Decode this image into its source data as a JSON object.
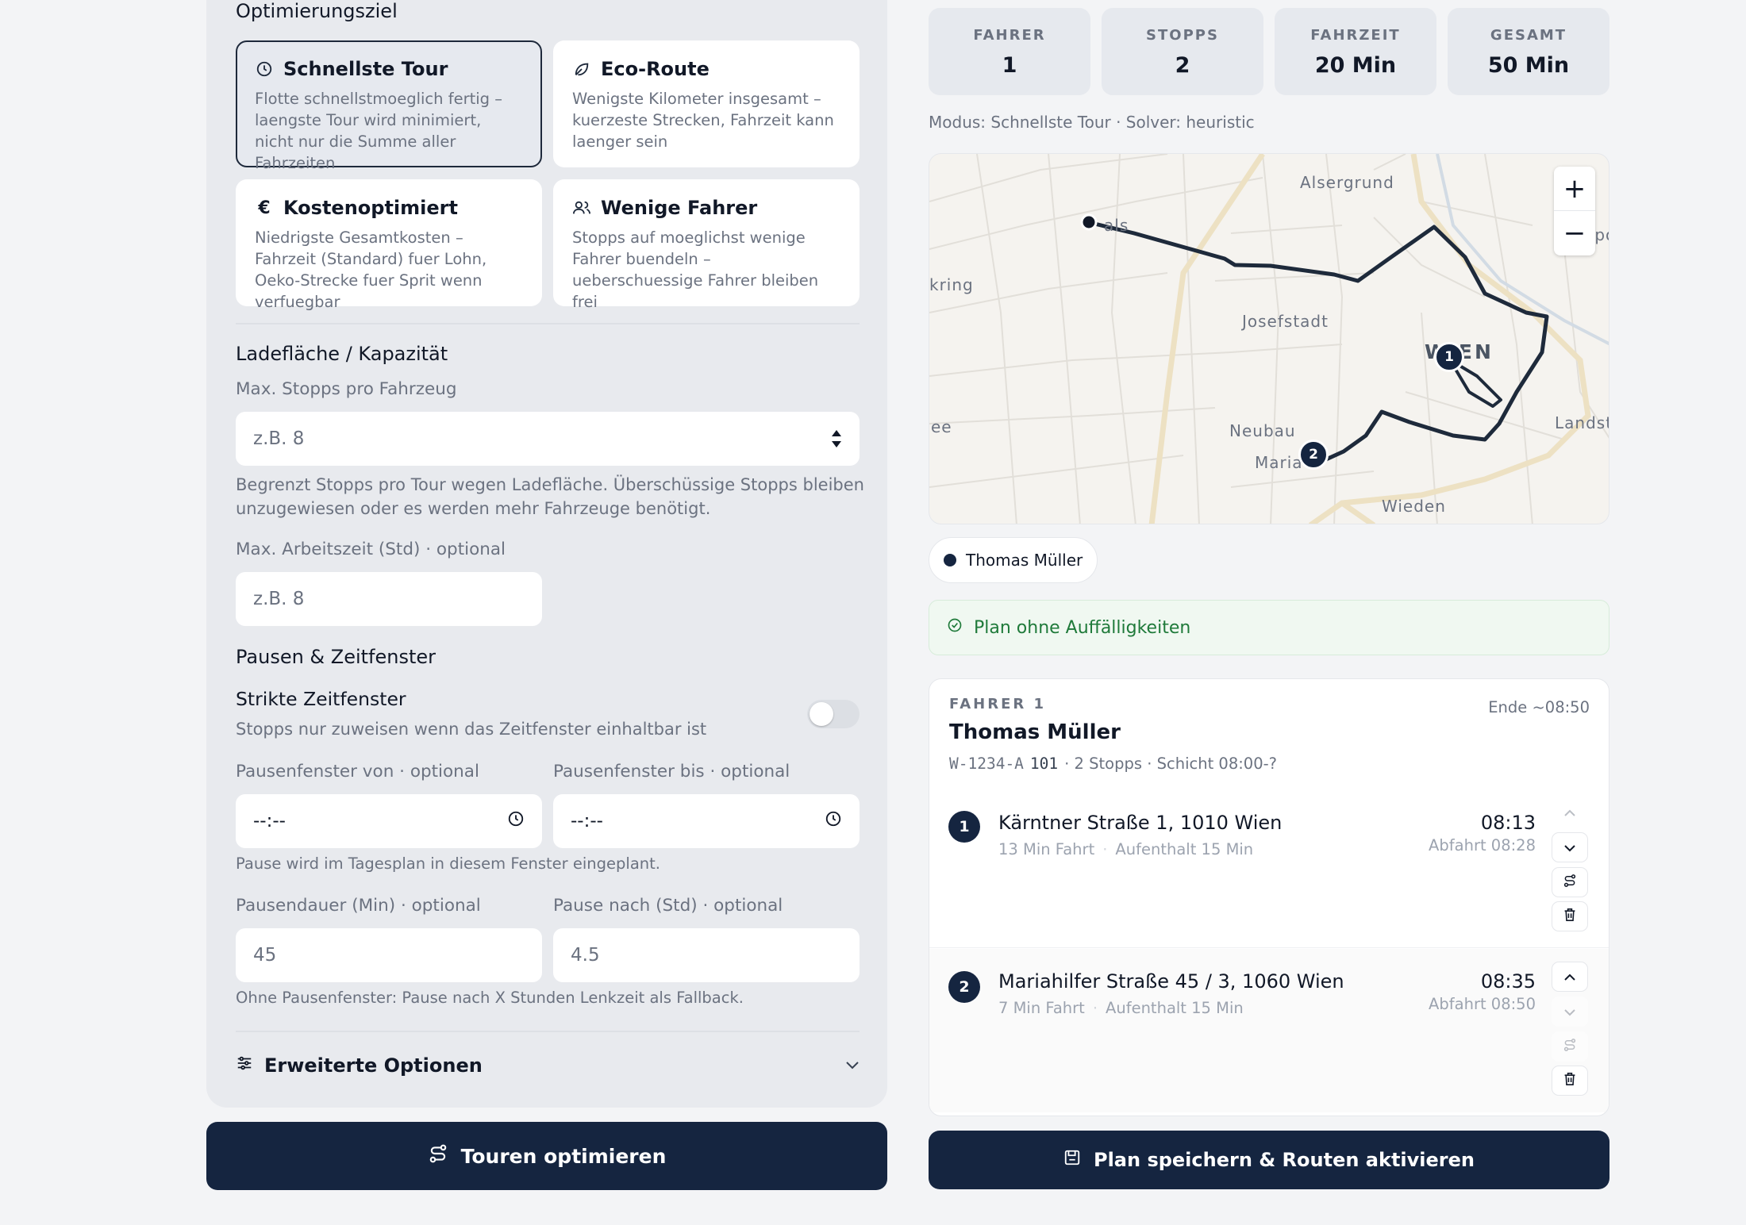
{
  "left": {
    "goal_title": "Optimierungsziel",
    "goals": [
      {
        "icon": "clock-icon",
        "title": "Schnellste Tour",
        "desc": "Flotte schnellstmoeglich fertig – laengste Tour wird minimiert, nicht nur die Summe aller Fahrzeiten",
        "selected": true
      },
      {
        "icon": "leaf-icon",
        "title": "Eco-Route",
        "desc": "Wenigste Kilometer insgesamt – kuerzeste Strecken, Fahrzeit kann laenger sein",
        "selected": false
      },
      {
        "icon": "euro-icon",
        "title": "Kostenoptimiert",
        "desc": "Niedrigste Gesamtkosten – Fahrzeit (Standard) fuer Lohn, Oeko-Strecke fuer Sprit wenn verfuegbar",
        "selected": false
      },
      {
        "icon": "users-icon",
        "title": "Wenige Fahrer",
        "desc": "Stopps auf moeglichst wenige Fahrer buendeln – ueberschuessige Fahrer bleiben frei",
        "selected": false
      }
    ],
    "capacity_title": "Ladefläche / Kapazität",
    "max_stops_label": "Max. Stopps pro Fahrzeug",
    "max_stops_placeholder": "z.B. 8",
    "max_stops_hint": "Begrenzt Stopps pro Tour wegen Ladefläche. Überschüssige Stopps bleiben unzugewiesen oder es werden mehr Fahrzeuge benötigt.",
    "max_work_label": "Max. Arbeitszeit (Std) · optional",
    "max_work_placeholder": "z.B. 8",
    "breaks_title": "Pausen & Zeitfenster",
    "strict_title": "Strikte Zeitfenster",
    "strict_desc": "Stopps nur zuweisen wenn das Zeitfenster einhaltbar ist",
    "strict_enabled": false,
    "break_from_label": "Pausenfenster von · optional",
    "break_to_label": "Pausenfenster bis · optional",
    "time_placeholder": "--:--",
    "break_window_hint": "Pause wird im Tagesplan in diesem Fenster eingeplant.",
    "break_duration_label": "Pausendauer (Min) · optional",
    "break_after_label": "Pause nach (Std) · optional",
    "break_duration_placeholder": "45",
    "break_after_placeholder": "4.5",
    "fallback_hint": "Ohne Pausenfenster: Pause nach X Stunden Lenkzeit als Fallback.",
    "advanced_label": "Erweiterte Optionen",
    "optimize_button": "Touren optimieren"
  },
  "right": {
    "stats": [
      {
        "label": "FAHRER",
        "value": "1"
      },
      {
        "label": "STOPPS",
        "value": "2"
      },
      {
        "label": "FAHRZEIT",
        "value": "20 Min"
      },
      {
        "label": "GESAMT",
        "value": "50 Min"
      }
    ],
    "mode_line": "Modus: Schnellste Tour · Solver: heuristic",
    "map_labels": {
      "alsergrund": "Alsergrund",
      "josefstadt": "Josefstadt",
      "neubau": "Neubau",
      "wieden": "Wieden",
      "landst": "Landst",
      "kring": "kring",
      "ee": "ee",
      "maria": "Maria",
      "wien": "WIEN",
      "als": "als",
      "leop": "Leopol"
    },
    "zoom_in": "+",
    "zoom_out": "−",
    "driver_chip": "Thomas Müller",
    "status_banner": "Plan ohne Auffälligkeiten",
    "tour": {
      "driver_label": "FAHRER 1",
      "driver_name": "Thomas Müller",
      "end_time": "Ende ~08:50",
      "plate": "W-1234-A",
      "vehicle_no": "101",
      "summary": "· 2 Stopps · Schicht 08:00-?",
      "stops": [
        {
          "num": "1",
          "address": "Kärntner Straße 1, 1010 Wien",
          "drive": "13 Min Fahrt",
          "stay": "Aufenthalt 15 Min",
          "arrival": "08:13",
          "departure": "Abfahrt 08:28"
        },
        {
          "num": "2",
          "address": "Mariahilfer Straße 45 / 3, 1060 Wien",
          "drive": "7 Min Fahrt",
          "stay": "Aufenthalt 15 Min",
          "arrival": "08:35",
          "departure": "Abfahrt 08:50"
        }
      ]
    },
    "save_button": "Plan speichern & Routen aktivieren"
  },
  "colors": {
    "primary": "#152540",
    "success": "#1f7a3a",
    "selected_card": "#e6e9ef"
  }
}
